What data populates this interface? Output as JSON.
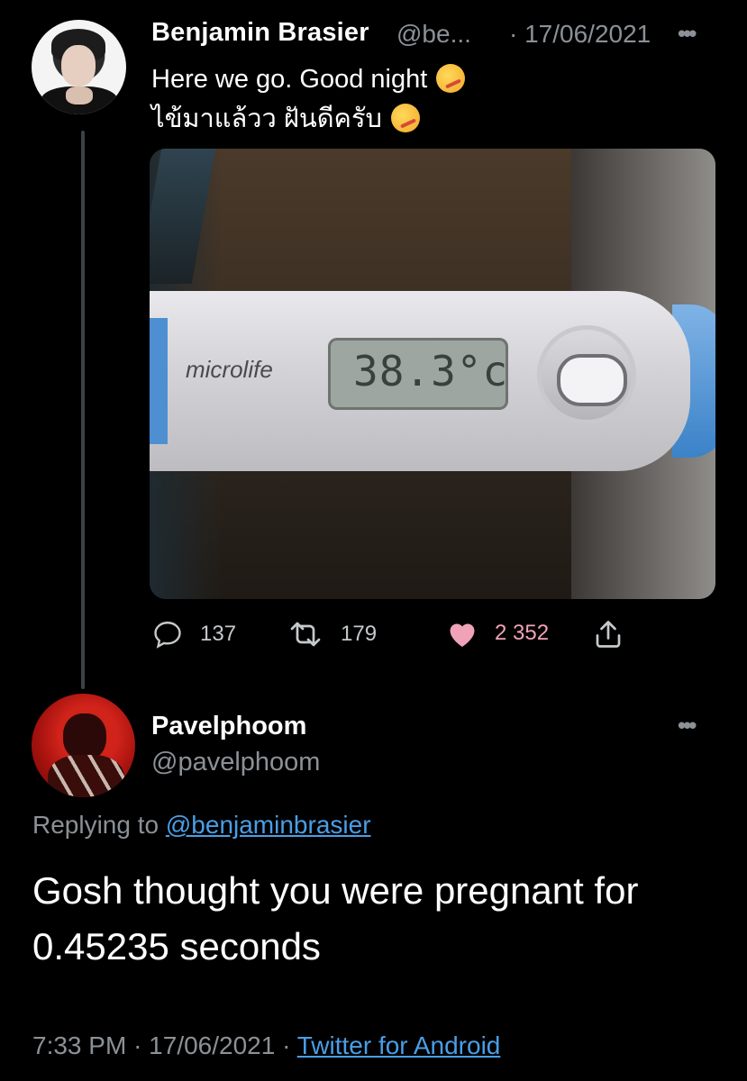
{
  "tweet1": {
    "author_name": "Benjamin Brasier",
    "handle": "@be...",
    "date": "· 17/06/2021",
    "more_label": "•••",
    "text_line1": "Here we go. Good night",
    "text_line2": "ไข้มาแล้วว ฝันดีครับ",
    "emoji": "face-with-thermometer",
    "photo": {
      "brand": "microlife",
      "display_reading": "38.3°c"
    },
    "actions": {
      "replies": "137",
      "retweets": "179",
      "likes": "2 352"
    }
  },
  "tweet2": {
    "author_name": "Pavelphoom",
    "handle": "@pavelphoom",
    "more_label": "•••",
    "replying_prefix": "Replying to",
    "replying_handle": "@benjaminbrasier",
    "text": "Gosh thought you were pregnant for 0.45235 seconds",
    "time": "7:33 PM",
    "date": "17/06/2021",
    "separator": "·",
    "source": "Twitter for Android"
  },
  "colors": {
    "background": "#000000",
    "secondary_text": "#8b9196",
    "link": "#4a9ee6",
    "like_pink": "#f0a3b8"
  }
}
